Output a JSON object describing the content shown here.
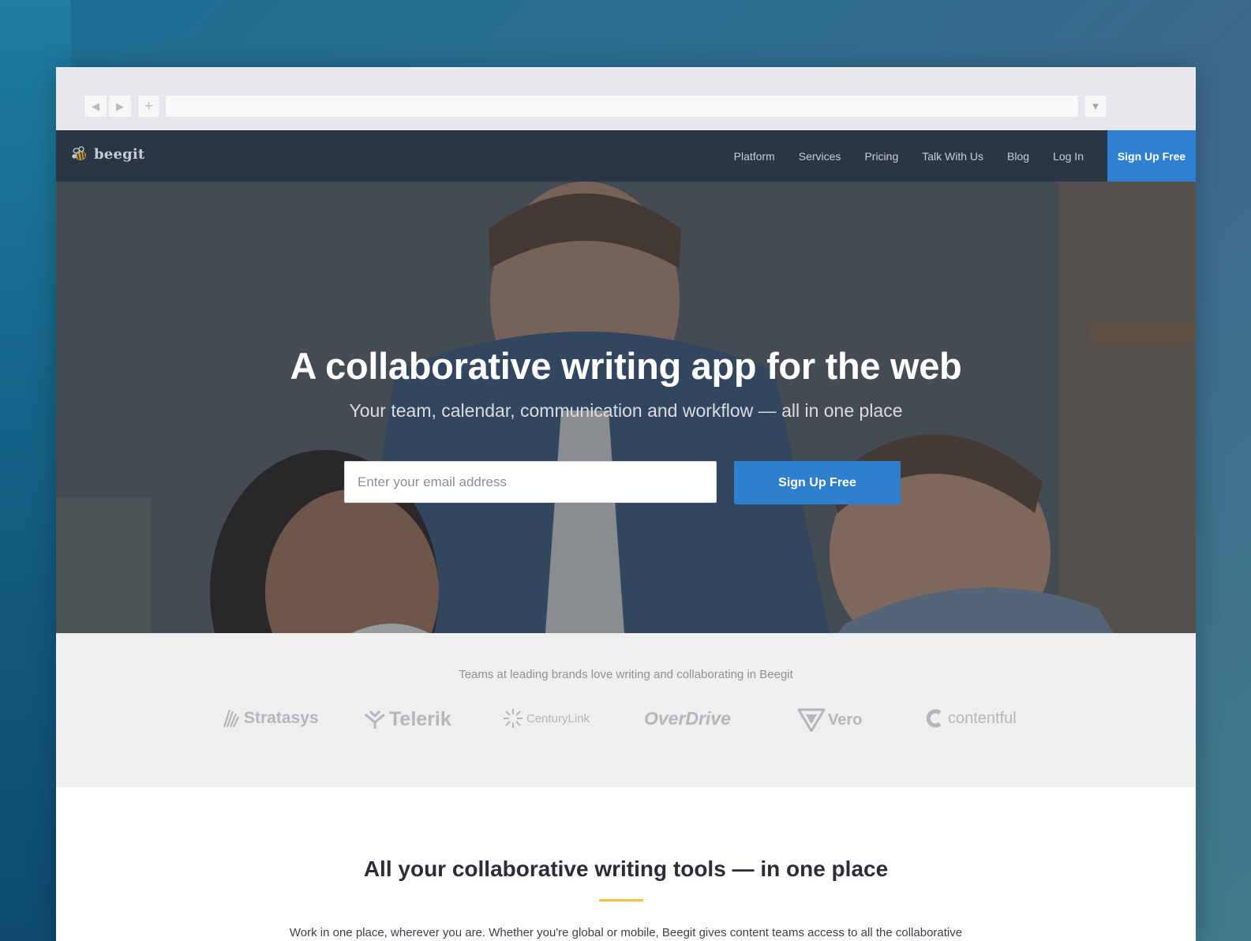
{
  "browser": {
    "back_glyph": "◀",
    "forward_glyph": "▶",
    "new_tab_glyph": "+",
    "menu_glyph": "▼",
    "address": ""
  },
  "site": {
    "logo_text": "beegit",
    "nav": [
      {
        "label": "Platform"
      },
      {
        "label": "Services"
      },
      {
        "label": "Pricing"
      },
      {
        "label": "Talk With Us"
      },
      {
        "label": "Blog"
      },
      {
        "label": "Log In"
      }
    ],
    "nav_cta": "Sign Up Free"
  },
  "hero": {
    "title": "A collaborative writing app for the web",
    "subtitle": "Your team, calendar, communication and workflow — all in one place",
    "email_placeholder": "Enter your email address",
    "email_value": "",
    "button_label": "Sign Up Free"
  },
  "brands": {
    "caption": "Teams at leading brands love writing and collaborating in Beegit",
    "logos": [
      {
        "name": "Stratasys",
        "icon": "stratasys-icon"
      },
      {
        "name": "Telerik",
        "icon": "telerik-icon"
      },
      {
        "name": "CenturyLink",
        "icon": "centurylink-icon"
      },
      {
        "name": "OverDrive",
        "icon": "overdrive-icon"
      },
      {
        "name": "Vero",
        "icon": "vero-icon"
      },
      {
        "name": "contentful",
        "icon": "contentful-icon"
      }
    ]
  },
  "tools": {
    "title": "All your collaborative writing tools — in one place",
    "text": "Work in one place, wherever you are. Whether you're global or mobile, Beegit gives content teams access to all the collaborative"
  },
  "colors": {
    "nav_bg": "#2b3645",
    "accent": "#2f80d1",
    "underline": "#f5c23d",
    "brands_bg": "#efefef"
  }
}
